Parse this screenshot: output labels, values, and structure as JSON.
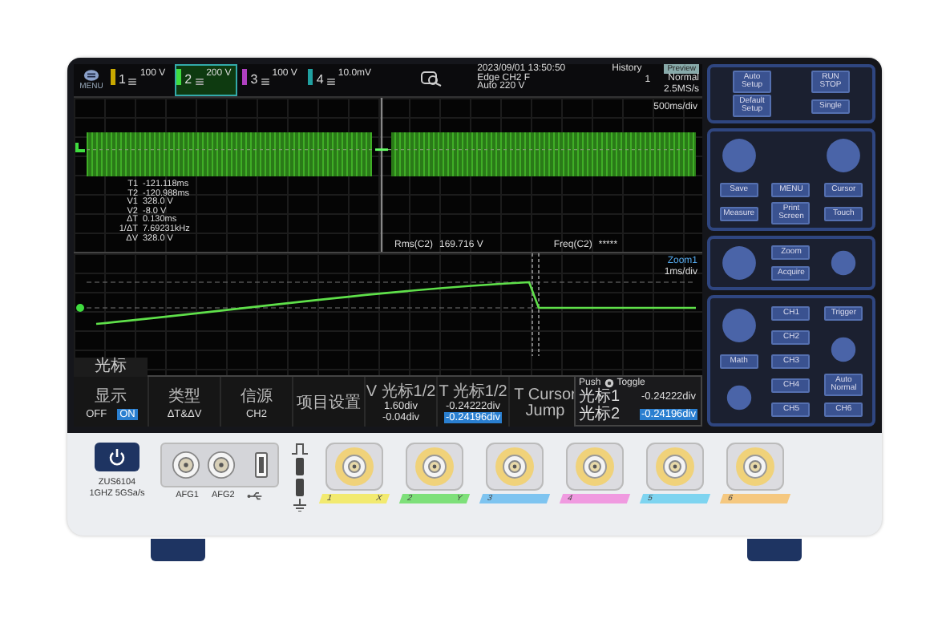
{
  "screen": {
    "menu_label": "MENU",
    "channels": [
      {
        "number": "1",
        "scale": "100 V",
        "selected": false,
        "color": "#c8a800"
      },
      {
        "number": "2",
        "scale": "200 V",
        "selected": true,
        "color": "#3fdc3f"
      },
      {
        "number": "3",
        "scale": "100 V",
        "selected": false,
        "color": "#b040c0"
      },
      {
        "number": "4",
        "scale": "10.0mV",
        "selected": false,
        "color": "#20a0a0"
      }
    ],
    "datetime": "2023/09/01 13:50:50",
    "trigger": [
      "Edge CH2 F",
      "Auto 220 V"
    ],
    "history": {
      "label": "History",
      "value": "1"
    },
    "acquisition": {
      "mode": "Normal",
      "rate": "2.5MS/s"
    },
    "badge": "Preview",
    "timebase": "500ms/div",
    "cursor_readouts": [
      {
        "label": "T1",
        "value": "-121.118ms"
      },
      {
        "label": "T2",
        "value": "-120.988ms"
      },
      {
        "label": "V1",
        "value": "328.0 V"
      },
      {
        "label": "V2",
        "value": "-8.0 V"
      },
      {
        "label": "ΔT",
        "value": "0.130ms"
      },
      {
        "label": "1/ΔT",
        "value": "7.69231kHz"
      },
      {
        "label": "ΔV",
        "value": "328.0 V"
      }
    ],
    "measurements": [
      {
        "label": "Rms(C2)",
        "value": "169.716 V"
      },
      {
        "label": "Freq(C2)",
        "value": "*****"
      }
    ],
    "zoom": {
      "label": "Zoom1",
      "timebase": "1ms/div"
    },
    "menu": {
      "title": "光标",
      "items": [
        {
          "kind": "toggle",
          "title": "显示",
          "options": [
            {
              "label": "OFF",
              "selected": false
            },
            {
              "label": "ON",
              "selected": true
            }
          ]
        },
        {
          "kind": "value",
          "title": "类型",
          "value": "ΔT&ΔV"
        },
        {
          "kind": "value",
          "title": "信源",
          "value": "CH2"
        },
        {
          "kind": "action",
          "title": "项目设置"
        },
        {
          "kind": "pair",
          "title": "V 光标1/2",
          "values": [
            {
              "text": "1.60div",
              "selected": false
            },
            {
              "text": "-0.04div",
              "selected": false
            }
          ]
        },
        {
          "kind": "pair",
          "title": "T 光标1/2",
          "values": [
            {
              "text": "-0.24222div",
              "selected": false
            },
            {
              "text": "-0.24196div",
              "selected": true
            }
          ]
        },
        {
          "kind": "action",
          "title": "T Cursor Jump"
        }
      ]
    },
    "knob_panel": {
      "push": "Push",
      "toggle": "Toggle",
      "rows": [
        {
          "label": "光标1",
          "value": "-0.24222div",
          "selected": false
        },
        {
          "label": "光标2",
          "value": "-0.24196div",
          "selected": true
        }
      ]
    }
  },
  "control_panel": {
    "groups": [
      {
        "kind": "run",
        "buttons": [
          "Auto Setup",
          "RUN STOP",
          "Default Setup",
          "Single"
        ]
      },
      {
        "kind": "general",
        "buttons": [
          "Save",
          "MENU",
          "Cursor",
          "Measure",
          "Print Screen",
          "Touch"
        ]
      },
      {
        "kind": "horizontal",
        "buttons": [
          "Zoom",
          "Acquire"
        ]
      },
      {
        "kind": "vertical",
        "buttons": [
          "CH1",
          "Trigger",
          "CH2",
          "Math",
          "CH3",
          "CH4",
          "Auto Normal",
          "CH5",
          "CH6"
        ]
      }
    ]
  },
  "front_panel": {
    "model": "ZUS6104",
    "spec": "1GHZ 5GSa/s",
    "afg_labels": [
      "AFG1",
      "AFG2"
    ],
    "inputs": [
      {
        "number": "1",
        "axis": "X",
        "color": "#f2ea70"
      },
      {
        "number": "2",
        "axis": "Y",
        "color": "#7ee07a"
      },
      {
        "number": "3",
        "color": "#7ec4f0"
      },
      {
        "number": "4",
        "color": "#f09ae0"
      },
      {
        "number": "5",
        "color": "#7ed4f0"
      },
      {
        "number": "6",
        "color": "#f5c880"
      }
    ]
  }
}
